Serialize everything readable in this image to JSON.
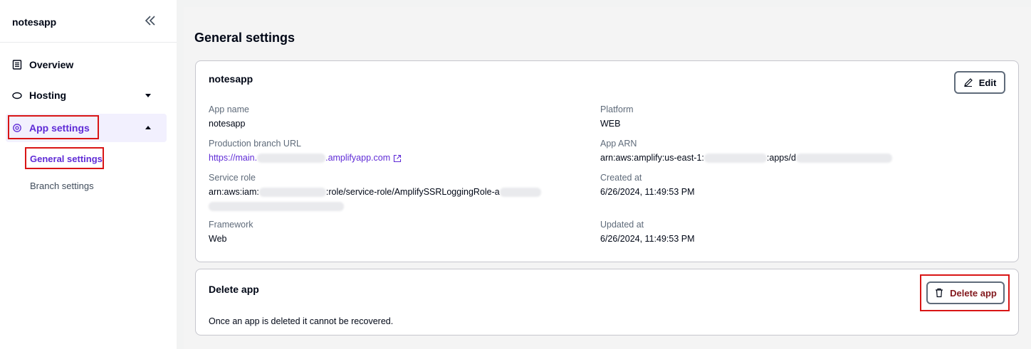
{
  "sidebar": {
    "app_name": "notesapp",
    "items": [
      {
        "label": "Overview",
        "icon": "document-icon"
      },
      {
        "label": "Hosting",
        "icon": "cloud-icon"
      },
      {
        "label": "App settings",
        "icon": "gear-icon"
      }
    ],
    "sub_items": [
      {
        "label": "General settings"
      },
      {
        "label": "Branch settings"
      }
    ]
  },
  "page": {
    "title": "General settings"
  },
  "general_card": {
    "title": "notesapp",
    "edit_label": "Edit",
    "fields": {
      "app_name": {
        "label": "App name",
        "value": "notesapp"
      },
      "prod_url": {
        "label": "Production branch URL",
        "value_start": "https://main.",
        "value_end": ".amplifyapp.com"
      },
      "service_role": {
        "label": "Service role",
        "value_start": "arn:aws:iam:",
        "value_mid": ":role/service-role/AmplifySSRLoggingRole-a"
      },
      "framework": {
        "label": "Framework",
        "value": "Web"
      },
      "platform": {
        "label": "Platform",
        "value": "WEB"
      },
      "app_arn": {
        "label": "App ARN",
        "value_start": "arn:aws:amplify:us-east-1:",
        "value_mid": ":apps/d"
      },
      "created_at": {
        "label": "Created at",
        "value": "6/26/2024, 11:49:53 PM"
      },
      "updated_at": {
        "label": "Updated at",
        "value": "6/26/2024, 11:49:53 PM"
      }
    }
  },
  "delete_card": {
    "title": "Delete app",
    "button_label": "Delete app",
    "description": "Once an app is deleted it cannot be recovered."
  },
  "colors": {
    "accent": "#5f2bd6",
    "highlight": "#d91515",
    "danger_text": "#82181d"
  }
}
